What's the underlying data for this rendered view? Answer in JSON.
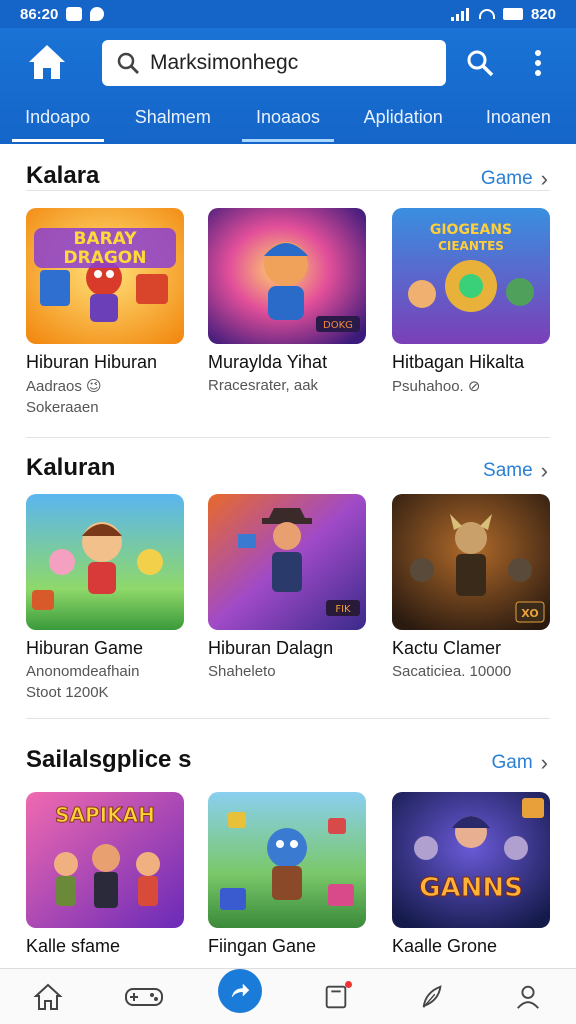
{
  "status": {
    "time": "86:20",
    "battery": "820"
  },
  "header": {
    "search_value": "Marksimonhegc"
  },
  "tabs": [
    {
      "label": "Indoapo",
      "state": "active"
    },
    {
      "label": "Shalmem",
      "state": "normal"
    },
    {
      "label": "Inoaaos",
      "state": "under"
    },
    {
      "label": "Aplidation",
      "state": "normal"
    },
    {
      "label": "Inoanen",
      "state": "normal"
    }
  ],
  "sections": [
    {
      "title": "Kalara",
      "more": "Game",
      "cards": [
        {
          "title": "Hiburan Hiburan",
          "sub": "Aadraos 😉",
          "sub2": "Sokeraaen",
          "badge": "BARAY DRAGON",
          "theme": "orange"
        },
        {
          "title": "Muraylda Yihat",
          "sub": "Rracesrater, aak",
          "sub2": "",
          "badge": "DOKG",
          "theme": "purple"
        },
        {
          "title": "Hitbagan Hikalta",
          "sub": "Psuhahoo. ⊘",
          "sub2": "",
          "badge": "GIOGEANS CIEANTES",
          "theme": "teal"
        }
      ]
    },
    {
      "title": "Kaluran",
      "more": "Same",
      "cards": [
        {
          "title": "Hiburan Game",
          "sub": "Anonomdeafhain",
          "sub2": "Stoot 1200K",
          "badge": "",
          "theme": "green"
        },
        {
          "title": "Hiburan Dalagn",
          "sub": "Shaheleto",
          "sub2": "",
          "badge": "FIK",
          "theme": "violet"
        },
        {
          "title": "Kactu Clamer",
          "sub": "Sacaticiea. 10000",
          "sub2": "",
          "badge": "XO",
          "theme": "dark"
        }
      ]
    },
    {
      "title": "Sailalsgplice s",
      "more": "Gam",
      "cards": [
        {
          "title": "Kalle sfame",
          "sub": "",
          "sub2": "",
          "badge": "SAPIKAH",
          "theme": "pink"
        },
        {
          "title": "Fiingan Gane",
          "sub": "",
          "sub2": "",
          "badge": "",
          "theme": "greenblue"
        },
        {
          "title": "Kaalle Grone",
          "sub": "",
          "sub2": "",
          "badge": "GANNS",
          "theme": "navy"
        }
      ]
    }
  ],
  "bottom_nav": [
    "home-icon",
    "controller-icon",
    "share-arrow-icon",
    "inbox-icon",
    "feather-icon",
    "profile-icon"
  ]
}
